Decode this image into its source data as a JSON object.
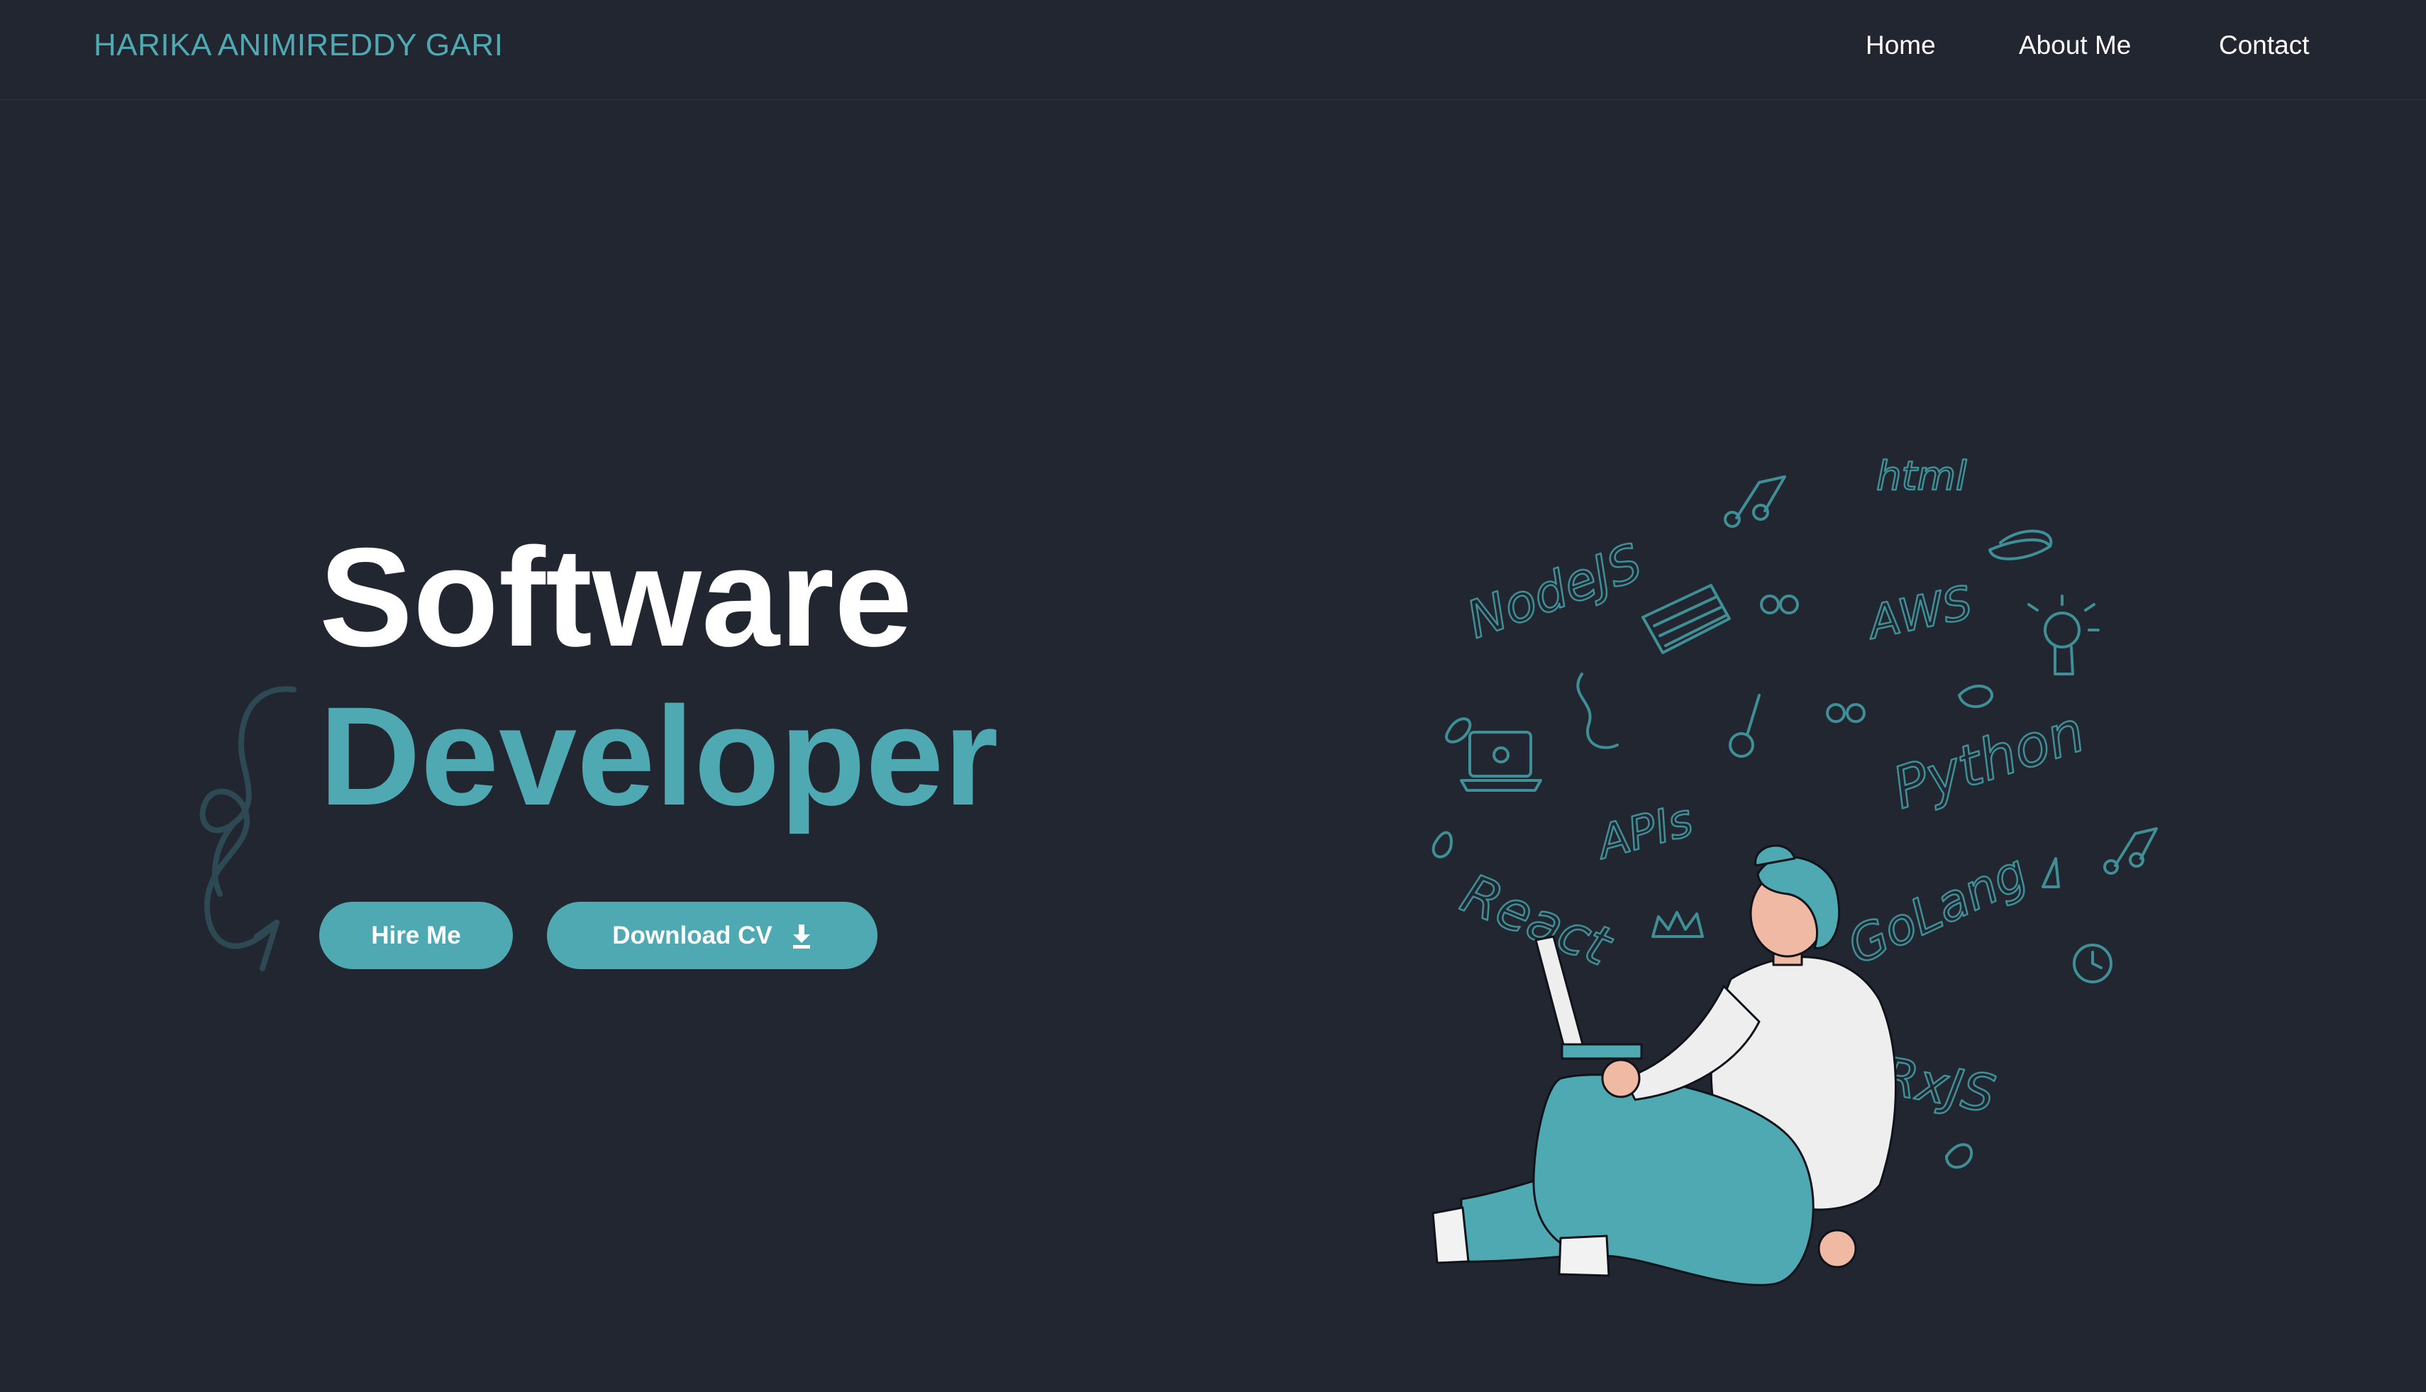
{
  "header": {
    "brand": "HARIKA ANIMIREDDY GARI",
    "nav": [
      {
        "label": "Home"
      },
      {
        "label": "About Me"
      },
      {
        "label": "Contact"
      }
    ]
  },
  "hero": {
    "title_line1": "Software",
    "title_line2": "Developer",
    "buttons": {
      "hire_label": "Hire Me",
      "download_label": "Download CV",
      "download_icon": "download-icon"
    }
  },
  "illustration": {
    "subject": "person-with-laptop",
    "doodle_words": [
      "html",
      "NodeJS",
      "AWS",
      "APIs",
      "Python",
      "React",
      "GoLang",
      "RxJS"
    ]
  },
  "colors": {
    "background": "#222630",
    "accent": "#4fa9b3",
    "text": "#ffffff"
  }
}
